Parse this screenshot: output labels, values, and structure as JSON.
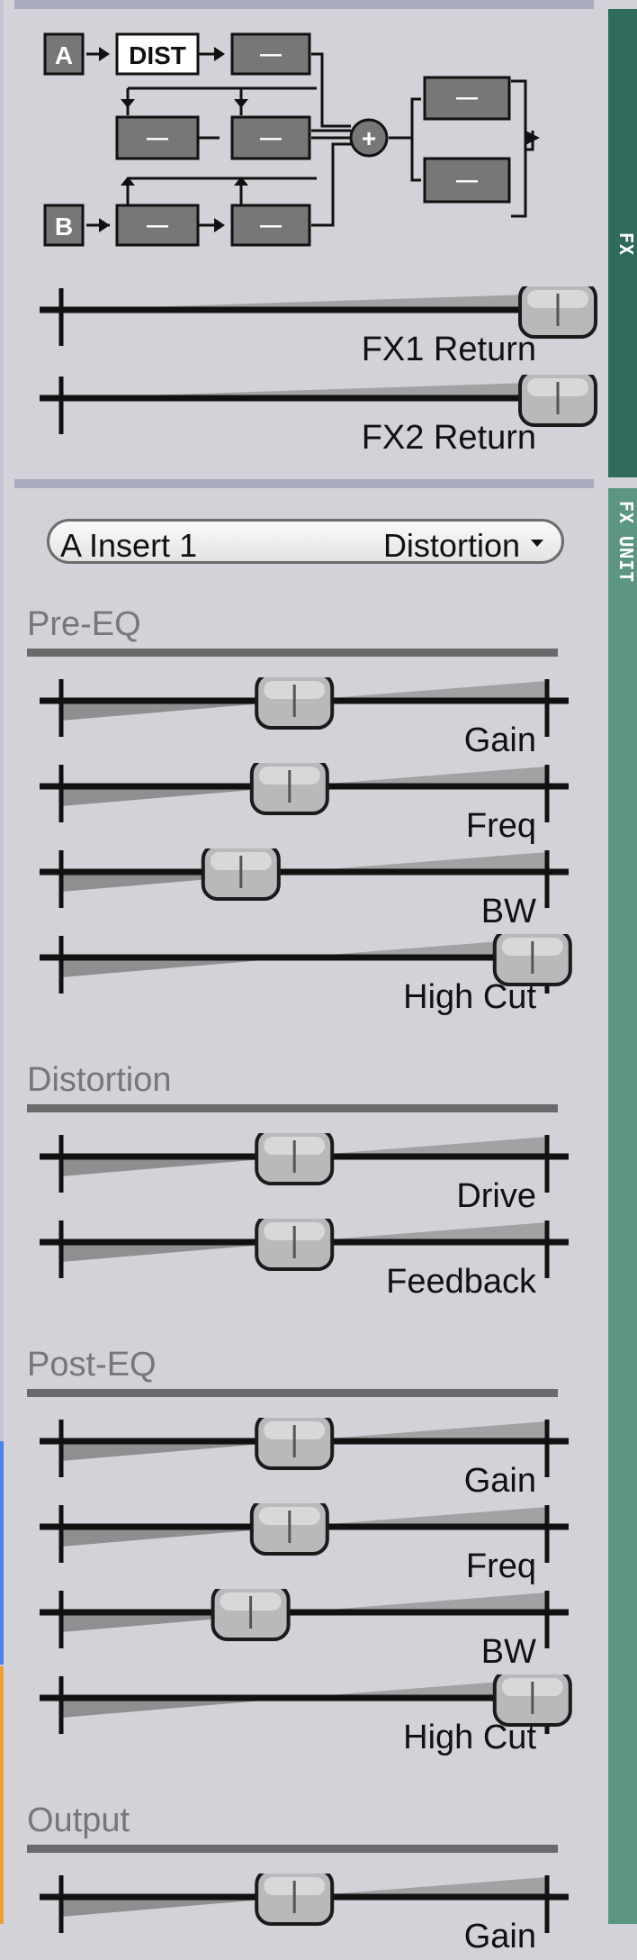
{
  "routing": {
    "input_a": "A",
    "input_b": "B",
    "dist": "DIST",
    "sum_symbol": "+",
    "slot_dash": "—"
  },
  "fx_returns": [
    {
      "label": "FX1 Return",
      "value": 1.0
    },
    {
      "label": "FX2 Return",
      "value": 1.0
    }
  ],
  "fx_unit": {
    "slot": "A Insert 1",
    "effect": "Distortion"
  },
  "sections": [
    {
      "title": "Pre-EQ",
      "params": [
        {
          "label": "Gain",
          "value": 0.48
        },
        {
          "label": "Freq",
          "value": 0.47
        },
        {
          "label": "BW",
          "value": 0.37
        },
        {
          "label": "High Cut",
          "value": 0.97
        }
      ]
    },
    {
      "title": "Distortion",
      "params": [
        {
          "label": "Drive",
          "value": 0.48
        },
        {
          "label": "Feedback",
          "value": 0.48
        }
      ]
    },
    {
      "title": "Post-EQ",
      "params": [
        {
          "label": "Gain",
          "value": 0.48
        },
        {
          "label": "Freq",
          "value": 0.47
        },
        {
          "label": "BW",
          "value": 0.39
        },
        {
          "label": "High Cut",
          "value": 0.97
        }
      ]
    },
    {
      "title": "Output",
      "params": [
        {
          "label": "Gain",
          "value": 0.48
        }
      ]
    }
  ],
  "tabs": {
    "fx": "FX",
    "fx_unit": "FX UNIT"
  },
  "colors": {
    "fx_tab": "#2f6b5a",
    "fx_unit_tab": "#5c9682",
    "background": "#d2d2d8"
  }
}
